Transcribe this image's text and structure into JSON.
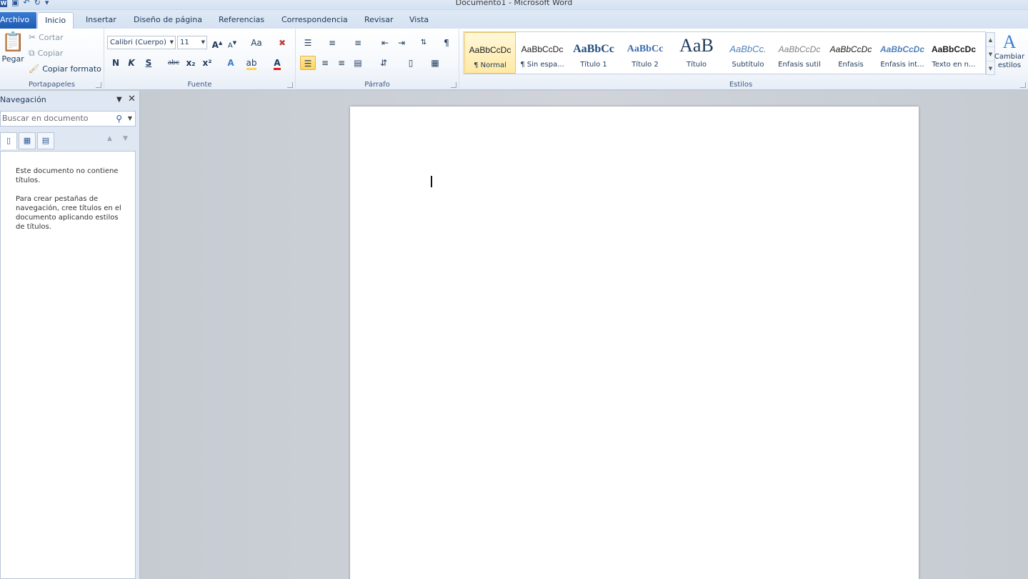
{
  "window": {
    "title": "Documento1  -  Microsoft Word"
  },
  "qat": {
    "icons": [
      "word-icon",
      "save-icon",
      "undo-icon",
      "redo-icon",
      "customize-icon"
    ]
  },
  "tabs": [
    {
      "label": "Archivo"
    },
    {
      "label": "Inicio"
    },
    {
      "label": "Insertar"
    },
    {
      "label": "Diseño de página"
    },
    {
      "label": "Referencias"
    },
    {
      "label": "Correspondencia"
    },
    {
      "label": "Revisar"
    },
    {
      "label": "Vista"
    }
  ],
  "clipboard": {
    "label": "Portapapeles",
    "paste": "Pegar",
    "cut": "Cortar",
    "copy": "Copiar",
    "format_painter": "Copiar formato"
  },
  "font": {
    "label": "Fuente",
    "font_name": "Calibri (Cuerpo)",
    "font_size": "11",
    "bold": "N",
    "italic": "K",
    "underline": "S",
    "strike": "abc",
    "subscript": "x₂",
    "superscript": "x²",
    "change_case": "Aa"
  },
  "paragraph": {
    "label": "Párrafo"
  },
  "styles": {
    "label": "Estilos",
    "change_styles": "Cambiar estilos",
    "items": [
      {
        "sample": "AaBbCcDc",
        "name": "¶ Normal"
      },
      {
        "sample": "AaBbCcDc",
        "name": "¶ Sin espa..."
      },
      {
        "sample": "AaBbCc",
        "name": "Título 1"
      },
      {
        "sample": "AaBbCc",
        "name": "Título 2"
      },
      {
        "sample": "AaB",
        "name": "Título"
      },
      {
        "sample": "AaBbCc.",
        "name": "Subtítulo"
      },
      {
        "sample": "AaBbCcDc",
        "name": "Énfasis sutil"
      },
      {
        "sample": "AaBbCcDc",
        "name": "Énfasis"
      },
      {
        "sample": "AaBbCcDc",
        "name": "Énfasis int..."
      },
      {
        "sample": "AaBbCcDc",
        "name": "Texto en n..."
      }
    ],
    "selected_index": 0
  },
  "navigation": {
    "title": "Navegación",
    "search_placeholder": "Buscar en documento",
    "message_1": "Este documento no contiene títulos.",
    "message_2": "Para crear pestañas de navegación, cree títulos en el documento aplicando estilos de títulos."
  },
  "colors": {
    "file_tab": "#1e5bb4",
    "highlight": "#ffd35a",
    "font_color": "#e01c1c",
    "accent": "#2b579a"
  }
}
